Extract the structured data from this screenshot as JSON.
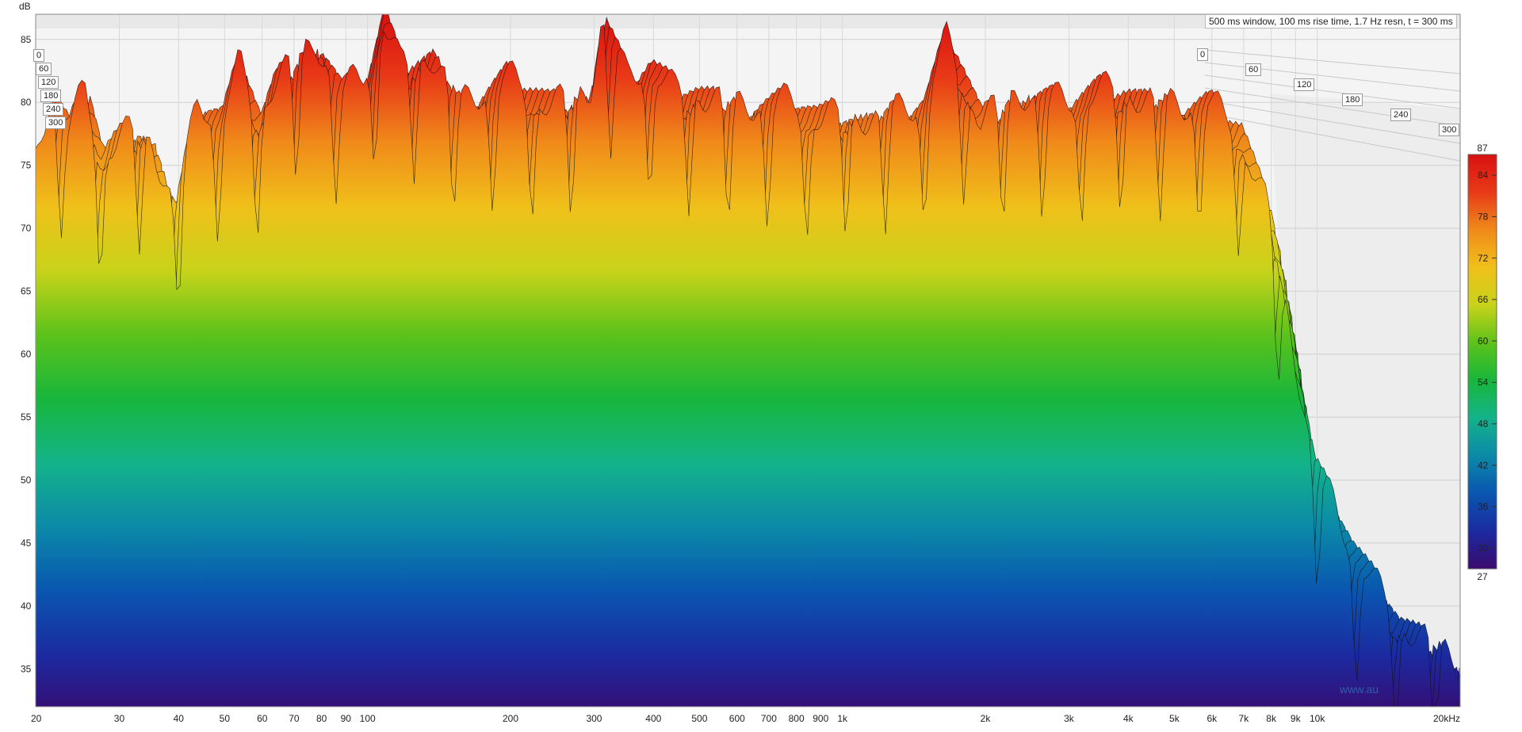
{
  "chart_data": {
    "type": "waterfall",
    "title": "500 ms window, 100 ms rise time,  1.7 Hz resn, t = 300 ms",
    "ylabel": "dB",
    "xlabel": "",
    "x_scale": "log",
    "xlim": [
      20,
      20000
    ],
    "ylim": [
      32,
      87
    ],
    "z_unit": "ms",
    "zlim": [
      0,
      300
    ],
    "x_ticks": [
      "20",
      "30",
      "40",
      "50",
      "60",
      "70",
      "80",
      "90",
      "100",
      "200",
      "300",
      "400",
      "500",
      "600",
      "700",
      "800",
      "900",
      "1k",
      "2k",
      "3k",
      "4k",
      "5k",
      "6k",
      "7k",
      "8k",
      "9k",
      "10k",
      "20kHz"
    ],
    "x_tick_values": [
      20,
      30,
      40,
      50,
      60,
      70,
      80,
      90,
      100,
      200,
      300,
      400,
      500,
      600,
      700,
      800,
      900,
      1000,
      2000,
      3000,
      4000,
      5000,
      6000,
      7000,
      8000,
      9000,
      10000,
      20000
    ],
    "y_ticks": [
      35,
      40,
      45,
      50,
      55,
      60,
      65,
      70,
      75,
      80,
      85
    ],
    "time_ticks_left": [
      "0",
      "60",
      "120",
      "180",
      "240",
      "300"
    ],
    "time_ticks_right": [
      "0",
      "60",
      "120",
      "180",
      "240",
      "300"
    ],
    "colorbar": {
      "min_label": "27",
      "max_label": "87",
      "ticks": [
        30,
        36,
        42,
        48,
        54,
        60,
        66,
        72,
        78,
        84
      ],
      "colors": [
        "#3a0a6e",
        "#1b2aa0",
        "#0a56b0",
        "#0b8aa8",
        "#13b38a",
        "#18b63c",
        "#5cc21a",
        "#c8d31a",
        "#f0c01a",
        "#f08a1a",
        "#e83a18",
        "#d81010"
      ]
    },
    "series": [
      {
        "values": [
          {
            "x": 20,
            "y": 74
          },
          {
            "x": 22,
            "y": 81
          },
          {
            "x": 24,
            "y": 78
          },
          {
            "x": 26,
            "y": 81
          },
          {
            "x": 28,
            "y": 76
          },
          {
            "x": 30,
            "y": 77
          },
          {
            "x": 33,
            "y": 78
          },
          {
            "x": 36,
            "y": 77
          },
          {
            "x": 40,
            "y": 72
          },
          {
            "x": 45,
            "y": 80
          },
          {
            "x": 50,
            "y": 79
          },
          {
            "x": 55,
            "y": 83
          },
          {
            "x": 60,
            "y": 79
          },
          {
            "x": 65,
            "y": 82
          },
          {
            "x": 70,
            "y": 83
          },
          {
            "x": 80,
            "y": 85
          },
          {
            "x": 90,
            "y": 81
          },
          {
            "x": 100,
            "y": 82
          },
          {
            "x": 110,
            "y": 87
          },
          {
            "x": 120,
            "y": 83
          },
          {
            "x": 140,
            "y": 84
          },
          {
            "x": 160,
            "y": 80
          },
          {
            "x": 200,
            "y": 82
          },
          {
            "x": 250,
            "y": 80
          },
          {
            "x": 300,
            "y": 81
          },
          {
            "x": 320,
            "y": 87
          },
          {
            "x": 360,
            "y": 82
          },
          {
            "x": 400,
            "y": 83
          },
          {
            "x": 450,
            "y": 81
          },
          {
            "x": 500,
            "y": 81
          },
          {
            "x": 600,
            "y": 80
          },
          {
            "x": 700,
            "y": 80
          },
          {
            "x": 800,
            "y": 80
          },
          {
            "x": 900,
            "y": 79
          },
          {
            "x": 1000,
            "y": 79
          },
          {
            "x": 1200,
            "y": 79
          },
          {
            "x": 1500,
            "y": 80
          },
          {
            "x": 1700,
            "y": 85
          },
          {
            "x": 2000,
            "y": 79
          },
          {
            "x": 2500,
            "y": 81
          },
          {
            "x": 3000,
            "y": 80
          },
          {
            "x": 3500,
            "y": 81
          },
          {
            "x": 4000,
            "y": 81
          },
          {
            "x": 5000,
            "y": 80
          },
          {
            "x": 6000,
            "y": 80
          },
          {
            "x": 7000,
            "y": 78
          },
          {
            "x": 8000,
            "y": 72
          },
          {
            "x": 9000,
            "y": 62
          },
          {
            "x": 10000,
            "y": 52
          },
          {
            "x": 12000,
            "y": 45
          },
          {
            "x": 15000,
            "y": 39
          },
          {
            "x": 20000,
            "y": 36
          }
        ]
      }
    ]
  },
  "watermark": "www.au"
}
